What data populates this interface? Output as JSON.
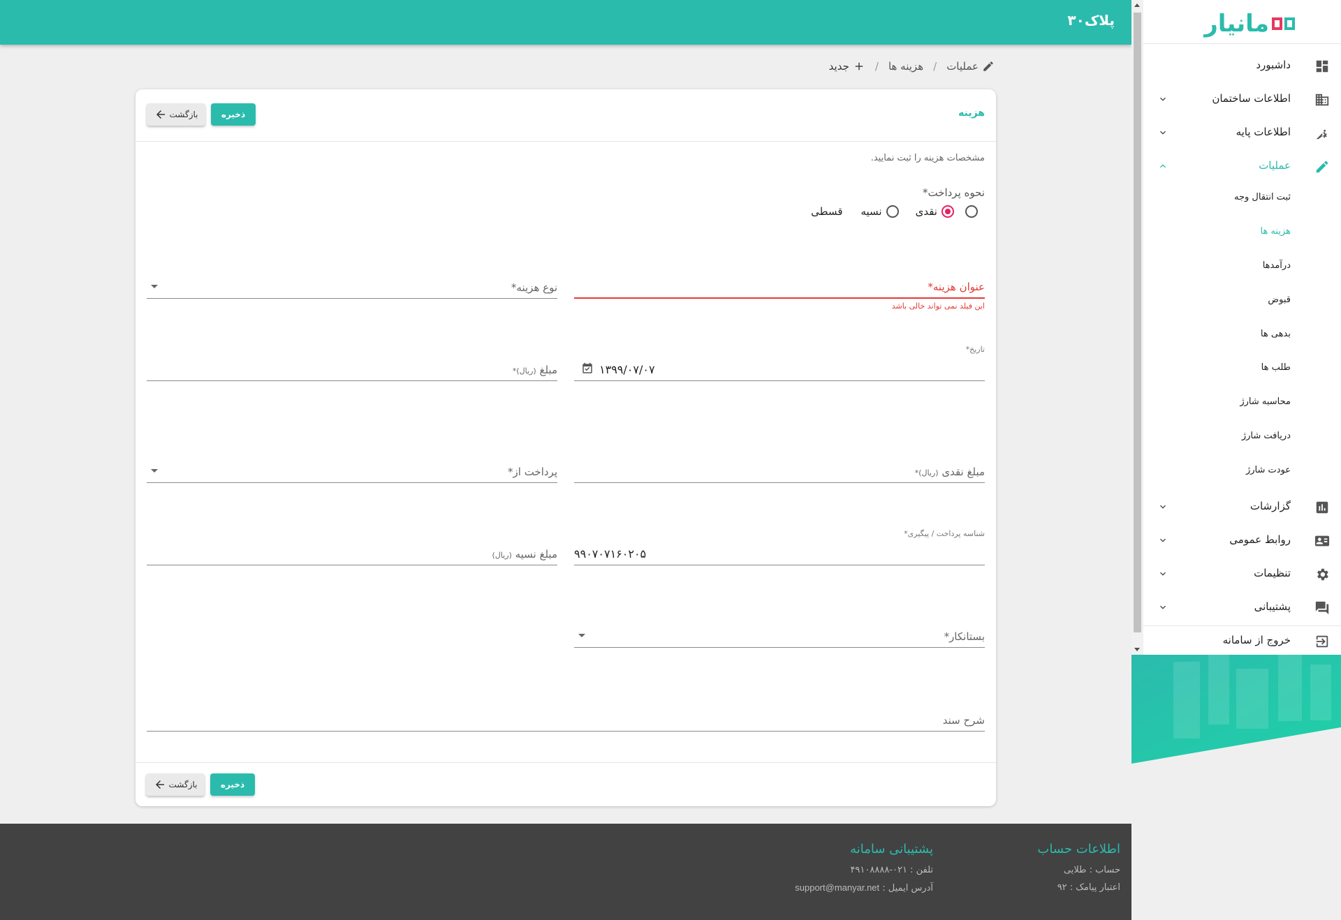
{
  "header": {
    "title": "پلاک۳۰"
  },
  "sidebar": {
    "logo_text": "مانیار",
    "items": [
      {
        "label": "داشبورد",
        "icon": "dashboard-icon"
      },
      {
        "label": "اطلاعات ساختمان",
        "icon": "building-icon"
      },
      {
        "label": "اطلاعات پایه",
        "icon": "settings-tool-icon"
      },
      {
        "label": "عملیات",
        "icon": "pencil-icon"
      },
      {
        "label": "گزارشات",
        "icon": "bar-chart-icon"
      },
      {
        "label": "روابط عمومی",
        "icon": "contact-card-icon"
      },
      {
        "label": "تنظیمات",
        "icon": "gear-icon"
      },
      {
        "label": "پشتیبانی",
        "icon": "chat-icon"
      },
      {
        "label": "خروج از سامانه",
        "icon": "logout-icon"
      }
    ],
    "sub_items": [
      {
        "label": "ثبت انتقال وجه"
      },
      {
        "label": "هزینه ها"
      },
      {
        "label": "درآمدها"
      },
      {
        "label": "قبوض"
      },
      {
        "label": "بدهی ها"
      },
      {
        "label": "طلب ها"
      },
      {
        "label": "محاسبه شارژ"
      },
      {
        "label": "دریافت شارژ"
      },
      {
        "label": "عودت شارژ"
      }
    ]
  },
  "breadcrumb": {
    "operations": "عملیات",
    "sep": "/",
    "expenses": "هزینه ها",
    "new": "جدید"
  },
  "card": {
    "title": "هزینه",
    "save_label": "ذخیره",
    "back_label": "بازگشت",
    "hint": "مشخصات هزینه را ثبت نمایید.",
    "payment_method": {
      "label": "نحوه پرداخت*",
      "options": [
        "نقدی",
        "نسیه",
        "قسطی"
      ],
      "selected": "نقدی"
    },
    "fields": {
      "expense_title": {
        "label": "عنوان هزینه*",
        "error": "این فیلد نمی تواند خالی باشد"
      },
      "expense_type": {
        "label": "نوع هزینه*"
      },
      "date": {
        "label": "تاریخ*",
        "value": "۱۳۹۹/۰۷/۰۷"
      },
      "amount": {
        "label": "مبلغ",
        "unit": "(ریال)*"
      },
      "cash_amount": {
        "label": "مبلغ نقدی",
        "unit": "(ریال)*"
      },
      "paid_from": {
        "label": "پرداخت از*"
      },
      "tracking_id": {
        "label": "شناسه پرداخت / پیگیری*",
        "value": "۹۹۰۷۰۷۱۶۰۲۰۵"
      },
      "credit_amount": {
        "label": "مبلغ نسیه",
        "unit": "(ریال)"
      },
      "creditor": {
        "label": "بستانکار*"
      },
      "description": {
        "label": "شرح سند"
      }
    }
  },
  "footer": {
    "account": {
      "title": "اطلاعات حساب",
      "line1": "حساب : طلایی",
      "line2": "اعتبار پیامک : ۹۲"
    },
    "support": {
      "title": "پشتیبانی سامانه",
      "line1": "تلفن : ۰۲۱-۴۹۱۰۸۸۸۸",
      "line2_prefix": "آدرس ایمیل :",
      "line2_value": "support@manyar.net"
    }
  },
  "colors": {
    "accent": "#2bbbad",
    "error": "#e53935",
    "radio": "#e91e63",
    "footer": "#424242"
  }
}
